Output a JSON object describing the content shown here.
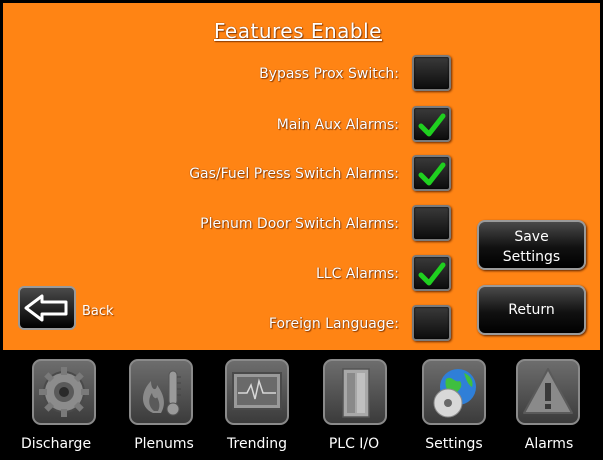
{
  "title": "Features Enable",
  "features": [
    {
      "label": "Bypass Prox Switch:",
      "checked": false
    },
    {
      "label": "Main Aux Alarms:",
      "checked": true
    },
    {
      "label": "Gas/Fuel Press Switch Alarms:",
      "checked": true
    },
    {
      "label": "Plenum Door Switch Alarms:",
      "checked": false
    },
    {
      "label": "LLC Alarms:",
      "checked": true
    },
    {
      "label": "Foreign Language:",
      "checked": false
    }
  ],
  "buttons": {
    "save_line1": "Save",
    "save_line2": "Settings",
    "return_label": "Return",
    "back_label": "Back"
  },
  "nav": [
    {
      "label": "Discharge",
      "icon": "gear-icon"
    },
    {
      "label": "Plenums",
      "icon": "flame-thermometer-icon"
    },
    {
      "label": "Trending",
      "icon": "monitor-trend-icon"
    },
    {
      "label": "PLC I/O",
      "icon": "plc-cabinet-icon"
    },
    {
      "label": "Settings",
      "icon": "globe-disc-icon"
    },
    {
      "label": "Alarms",
      "icon": "warning-triangle-icon"
    }
  ],
  "colors": {
    "panel": "#ff8414",
    "check": "#1fd01f",
    "nav_bg": "#000000"
  }
}
